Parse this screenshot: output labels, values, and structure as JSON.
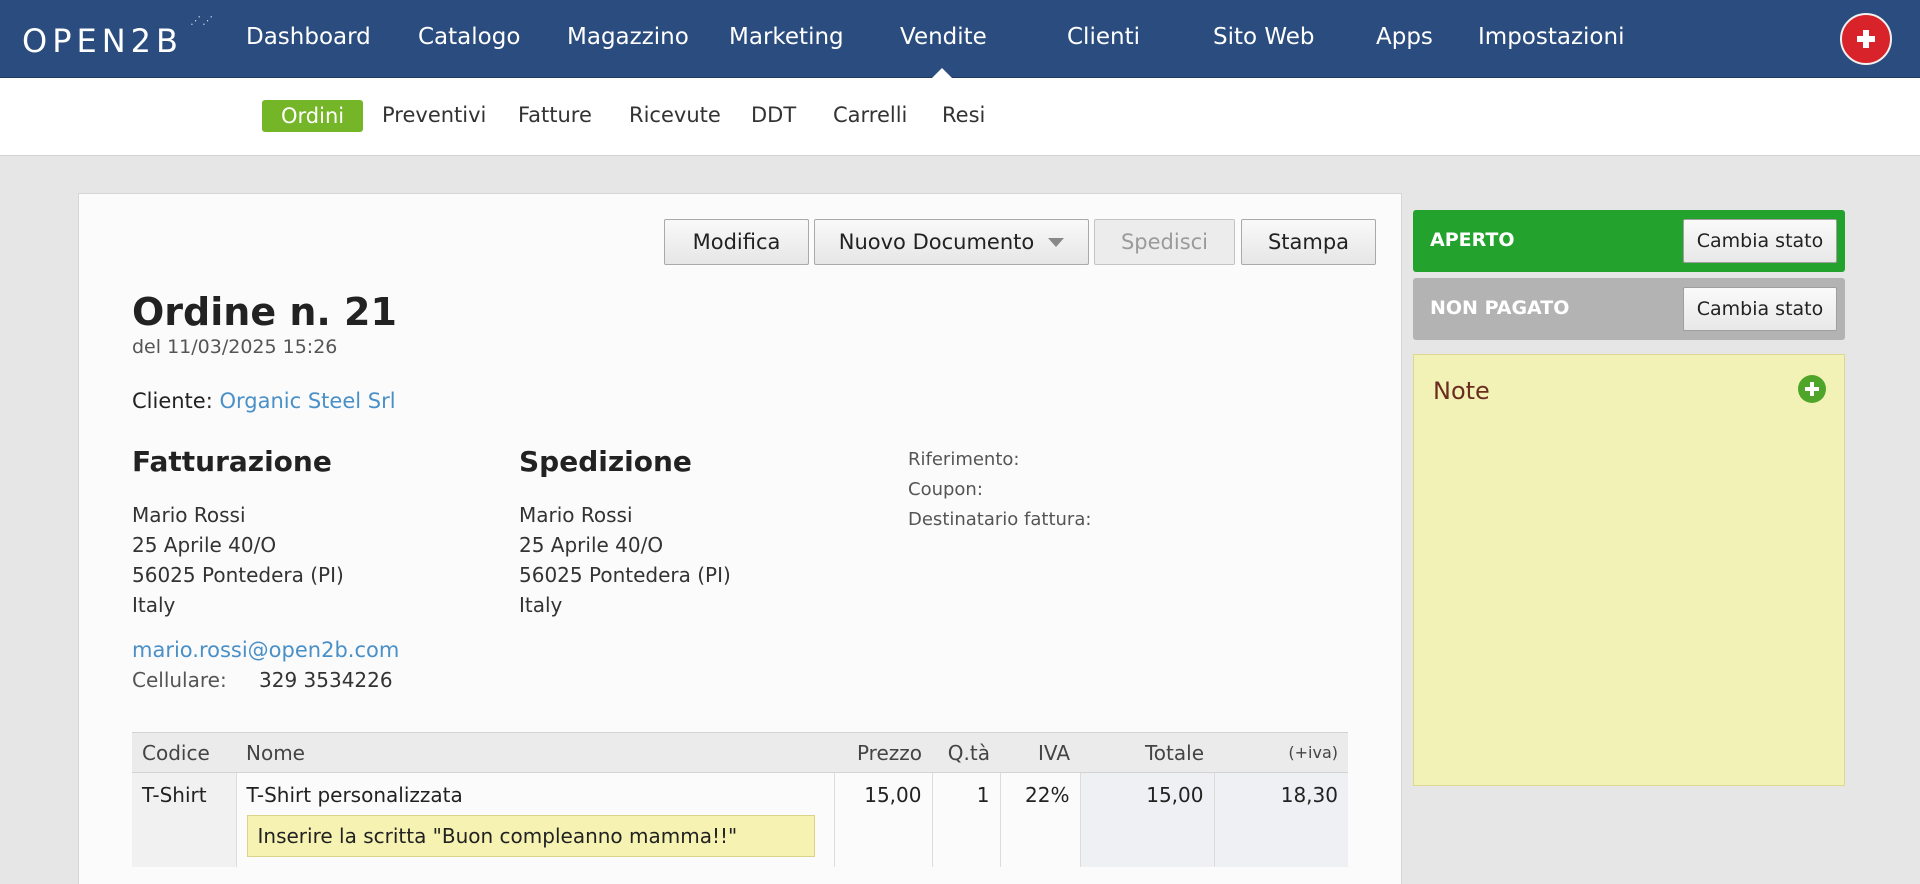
{
  "brand": {
    "logo": "OPEN2B",
    "dots": "⋰⋰"
  },
  "nav": {
    "items": [
      {
        "label": "Dashboard"
      },
      {
        "label": "Catalogo"
      },
      {
        "label": "Magazzino"
      },
      {
        "label": "Marketing"
      },
      {
        "label": "Vendite"
      },
      {
        "label": "Clienti"
      },
      {
        "label": "Sito Web"
      },
      {
        "label": "Apps"
      },
      {
        "label": "Impostazioni"
      }
    ],
    "active": "Vendite"
  },
  "subnav": {
    "items": [
      {
        "label": "Ordini"
      },
      {
        "label": "Preventivi"
      },
      {
        "label": "Fatture"
      },
      {
        "label": "Ricevute"
      },
      {
        "label": "DDT"
      },
      {
        "label": "Carrelli"
      },
      {
        "label": "Resi"
      }
    ],
    "active": "Ordini"
  },
  "toolbar": {
    "edit": "Modifica",
    "new_document": "Nuovo Documento",
    "ship": "Spedisci",
    "print": "Stampa"
  },
  "order": {
    "title": "Ordine n. 21",
    "date": "del 11/03/2025 15:26",
    "client_label": "Cliente:",
    "client_name": "Organic Steel Srl"
  },
  "billing": {
    "heading": "Fatturazione",
    "lines": [
      "Mario Rossi",
      "25 Aprile 40/O",
      "56025 Pontedera (PI)",
      "Italy"
    ]
  },
  "shipping": {
    "heading": "Spedizione",
    "lines": [
      "Mario Rossi",
      "25 Aprile 40/O",
      "56025 Pontedera (PI)",
      "Italy"
    ]
  },
  "meta": {
    "reference": "Riferimento:",
    "coupon": "Coupon:",
    "invoice_recipient": "Destinatario fattura:"
  },
  "contact": {
    "email": "mario.rossi@open2b.com",
    "phone_label": "Cellulare:",
    "phone": "329 3534226"
  },
  "table": {
    "headers": {
      "code": "Codice",
      "name": "Nome",
      "price": "Prezzo",
      "qty": "Q.tà",
      "vat": "IVA",
      "total": "Totale",
      "plus_vat": "(+iva)"
    },
    "rows": [
      {
        "code": "T-Shirt",
        "name": "T-Shirt personalizzata",
        "note": "Inserire la scritta \"Buon compleanno mamma!!\"",
        "price": "15,00",
        "qty": "1",
        "vat": "22%",
        "total": "15,00",
        "total_vat": "18,30"
      }
    ]
  },
  "status": {
    "open": "APERTO",
    "unpaid": "NON PAGATO",
    "change_label": "Cambia stato"
  },
  "notes": {
    "title": "Note"
  },
  "colors": {
    "nav_bg": "#2b4c7e",
    "active_sub": "#75b628",
    "status_open": "#24a22e",
    "status_unpaid": "#b3b3b3",
    "link": "#4a90c8",
    "note_bg": "#f3f2b6"
  }
}
